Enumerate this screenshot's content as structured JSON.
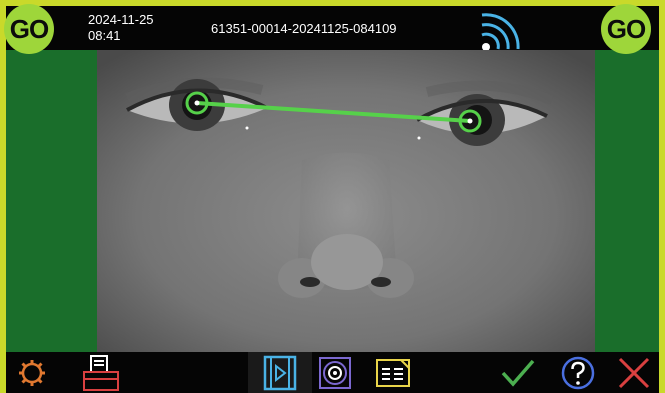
{
  "header": {
    "date": "2024-11-25",
    "time": "08:41",
    "session_id": "61351-00014-20241125-084109",
    "go_left_label": "GO",
    "go_right_label": "GO",
    "wifi_icon": "wifi-signal-icon"
  },
  "toolbar": {
    "settings_icon": "gear-icon",
    "print_icon": "printer-icon",
    "video_icon": "video-play-icon",
    "target_icon": "target-icon",
    "report_icon": "report-icon",
    "confirm_icon": "checkmark-icon",
    "help_icon": "question-icon",
    "cancel_icon": "close-icon"
  },
  "colors": {
    "frame": "#c9d92a",
    "go_badge": "#9ed63a",
    "side_panel": "#1a6e2b",
    "pupil_marker": "#56d14a",
    "icon_orange": "#e07830",
    "icon_blue": "#4ab3e6",
    "icon_purple": "#7b68d0",
    "icon_yellow": "#e9d54a",
    "icon_green": "#4caf50",
    "icon_red": "#d94040"
  }
}
